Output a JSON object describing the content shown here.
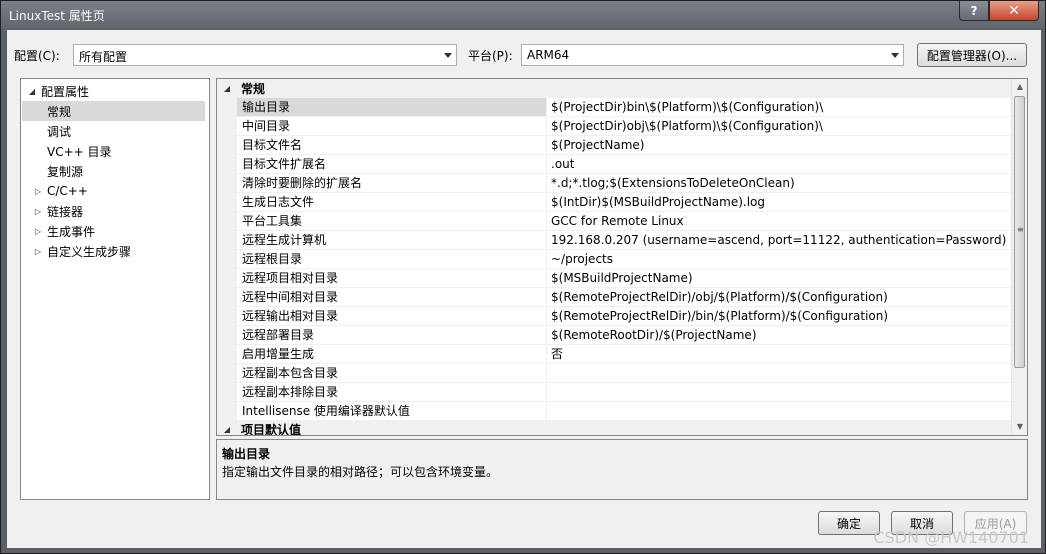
{
  "window": {
    "title": "LinuxTest 属性页",
    "help_glyph": "?",
    "close_glyph": "✕"
  },
  "config": {
    "label": "配置(C):",
    "value": "所有配置"
  },
  "platform": {
    "label": "平台(P):",
    "value": "ARM64"
  },
  "config_manager_label": "配置管理器(O)...",
  "tree": {
    "root": "配置属性",
    "items": [
      {
        "label": "常规",
        "expandable": false
      },
      {
        "label": "调试",
        "expandable": false
      },
      {
        "label": "VC++ 目录",
        "expandable": false
      },
      {
        "label": "复制源",
        "expandable": false
      },
      {
        "label": "C/C++",
        "expandable": true
      },
      {
        "label": "链接器",
        "expandable": true
      },
      {
        "label": "生成事件",
        "expandable": true
      },
      {
        "label": "自定义生成步骤",
        "expandable": true
      }
    ]
  },
  "grid": {
    "category": "常规",
    "properties": [
      {
        "name": "输出目录",
        "value": "$(ProjectDir)bin\\$(Platform)\\$(Configuration)\\"
      },
      {
        "name": "中间目录",
        "value": "$(ProjectDir)obj\\$(Platform)\\$(Configuration)\\"
      },
      {
        "name": "目标文件名",
        "value": "$(ProjectName)"
      },
      {
        "name": "目标文件扩展名",
        "value": ".out"
      },
      {
        "name": "清除时要删除的扩展名",
        "value": "*.d;*.tlog;$(ExtensionsToDeleteOnClean)"
      },
      {
        "name": "生成日志文件",
        "value": "$(IntDir)$(MSBuildProjectName).log"
      },
      {
        "name": "平台工具集",
        "value": "GCC for Remote Linux"
      },
      {
        "name": "远程生成计算机",
        "value": "192.168.0.207 (username=ascend, port=11122, authentication=Password)"
      },
      {
        "name": "远程根目录",
        "value": "~/projects"
      },
      {
        "name": "远程项目相对目录",
        "value": "$(MSBuildProjectName)"
      },
      {
        "name": "远程中间相对目录",
        "value": "$(RemoteProjectRelDir)/obj/$(Platform)/$(Configuration)"
      },
      {
        "name": "远程输出相对目录",
        "value": "$(RemoteProjectRelDir)/bin/$(Platform)/$(Configuration)"
      },
      {
        "name": "远程部署目录",
        "value": "$(RemoteRootDir)/$(ProjectName)"
      },
      {
        "name": "启用增量生成",
        "value": "否"
      },
      {
        "name": "远程副本包含目录",
        "value": ""
      },
      {
        "name": "远程副本排除目录",
        "value": ""
      },
      {
        "name": "Intellisense 使用编译器默认值",
        "value": ""
      }
    ],
    "category2": "项目默认值"
  },
  "description": {
    "title": "输出目录",
    "text": "指定输出文件目录的相对路径；可以包含环境变量。"
  },
  "buttons": {
    "ok": "确定",
    "cancel": "取消",
    "apply": "应用(A)"
  },
  "watermark": "CSDN @HW140701"
}
